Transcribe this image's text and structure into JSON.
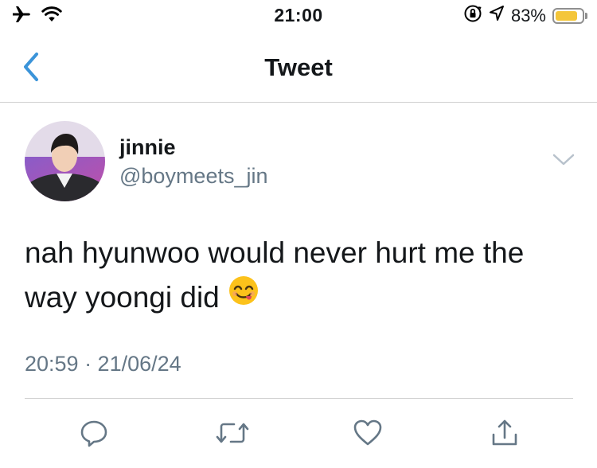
{
  "status_bar": {
    "time": "21:00",
    "battery_percent": "83%",
    "battery_level": 0.83,
    "battery_color": "#f4c63a",
    "left_icons": [
      "airplane-icon",
      "wifi-icon"
    ],
    "right_icons": [
      "orientation-lock-icon",
      "location-icon",
      "battery-icon"
    ]
  },
  "nav": {
    "title": "Tweet",
    "back_icon": "chevron-left-icon",
    "accent_color": "#3b94d9"
  },
  "tweet": {
    "display_name": "jinnie",
    "handle": "@boymeets_jin",
    "text": "nah hyunwoo would never hurt me the way yoongi did",
    "emoji": "😋",
    "timestamp": "20:59 · 21/06/24",
    "menu_icon": "chevron-down-icon"
  },
  "actions": [
    "reply-icon",
    "retweet-icon",
    "like-icon",
    "share-icon"
  ]
}
